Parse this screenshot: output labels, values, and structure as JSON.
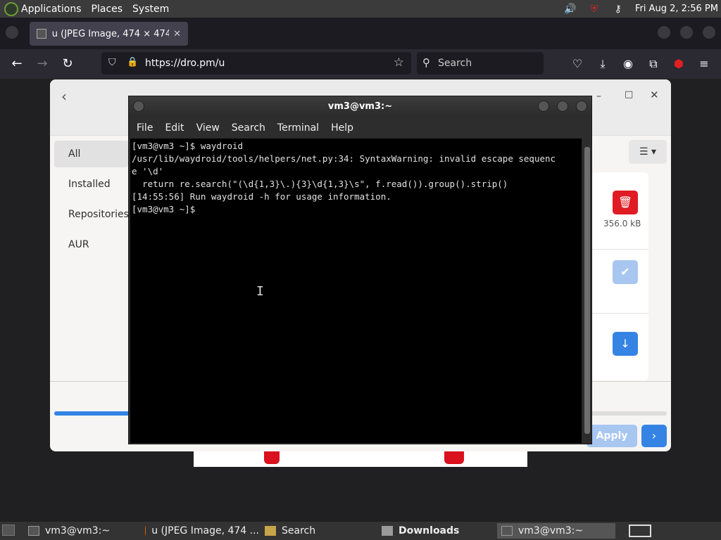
{
  "top_panel": {
    "menus": [
      "Applications",
      "Places",
      "System"
    ],
    "clock": "Fri Aug  2,  2:56 PM",
    "tray_icons": [
      "volume-icon",
      "shield-icon",
      "key-icon"
    ]
  },
  "firefox": {
    "tab_title": "u (JPEG Image, 474 × 474 pi",
    "url": "https://dro.pm/u",
    "search_placeholder": "Search"
  },
  "pamac": {
    "sidebar": [
      "All",
      "Installed",
      "Repositories",
      "AUR"
    ],
    "package_size": "356.0 kB",
    "apply_label": "Apply",
    "progress_fraction": 0.13
  },
  "terminal": {
    "title": "vm3@vm3:~",
    "menu": [
      "File",
      "Edit",
      "View",
      "Search",
      "Terminal",
      "Help"
    ],
    "output": "[vm3@vm3 ~]$ waydroid\n/usr/lib/waydroid/tools/helpers/net.py:34: SyntaxWarning: invalid escape sequenc\ne '\\d'\n  return re.search(\"(\\d{1,3}\\.){3}\\d{1,3}\\s\", f.read()).group().strip()\n[14:55:56] Run waydroid -h for usage information.\n[vm3@vm3 ~]$ "
  },
  "taskbar": {
    "tasks": [
      "vm3@vm3:~",
      "u (JPEG Image, 474 ...",
      "Search",
      "Downloads",
      "vm3@vm3:~"
    ]
  },
  "colors": {
    "accent_blue": "#3584e4",
    "delete_red": "#e01b24"
  }
}
